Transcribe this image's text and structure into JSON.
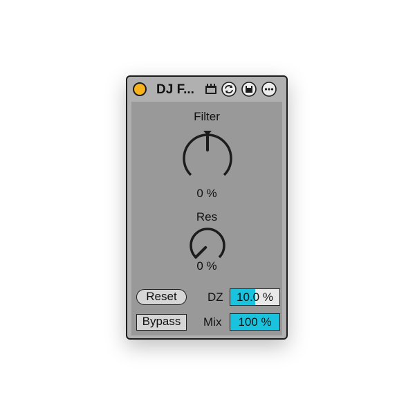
{
  "device": {
    "title": "DJ F...",
    "header_icons": [
      "save-preset-icon",
      "hot-swap-icon",
      "save-icon",
      "more-icon"
    ]
  },
  "filter": {
    "label": "Filter",
    "value": "0 %",
    "level": 0.5
  },
  "res": {
    "label": "Res",
    "value": "0 %",
    "level": 0.0
  },
  "reset_button": {
    "label": "Reset"
  },
  "bypass_button": {
    "label": "Bypass"
  },
  "dz": {
    "label": "DZ",
    "value": "10.0 %",
    "fill_fraction": 0.5
  },
  "mix": {
    "label": "Mix",
    "value": "100 %",
    "fill_fraction": 1.0
  },
  "colors": {
    "accent": "#1ac2dd",
    "power": "#f7b21c",
    "panel": "#999999",
    "frame": "#b0b0b0"
  }
}
